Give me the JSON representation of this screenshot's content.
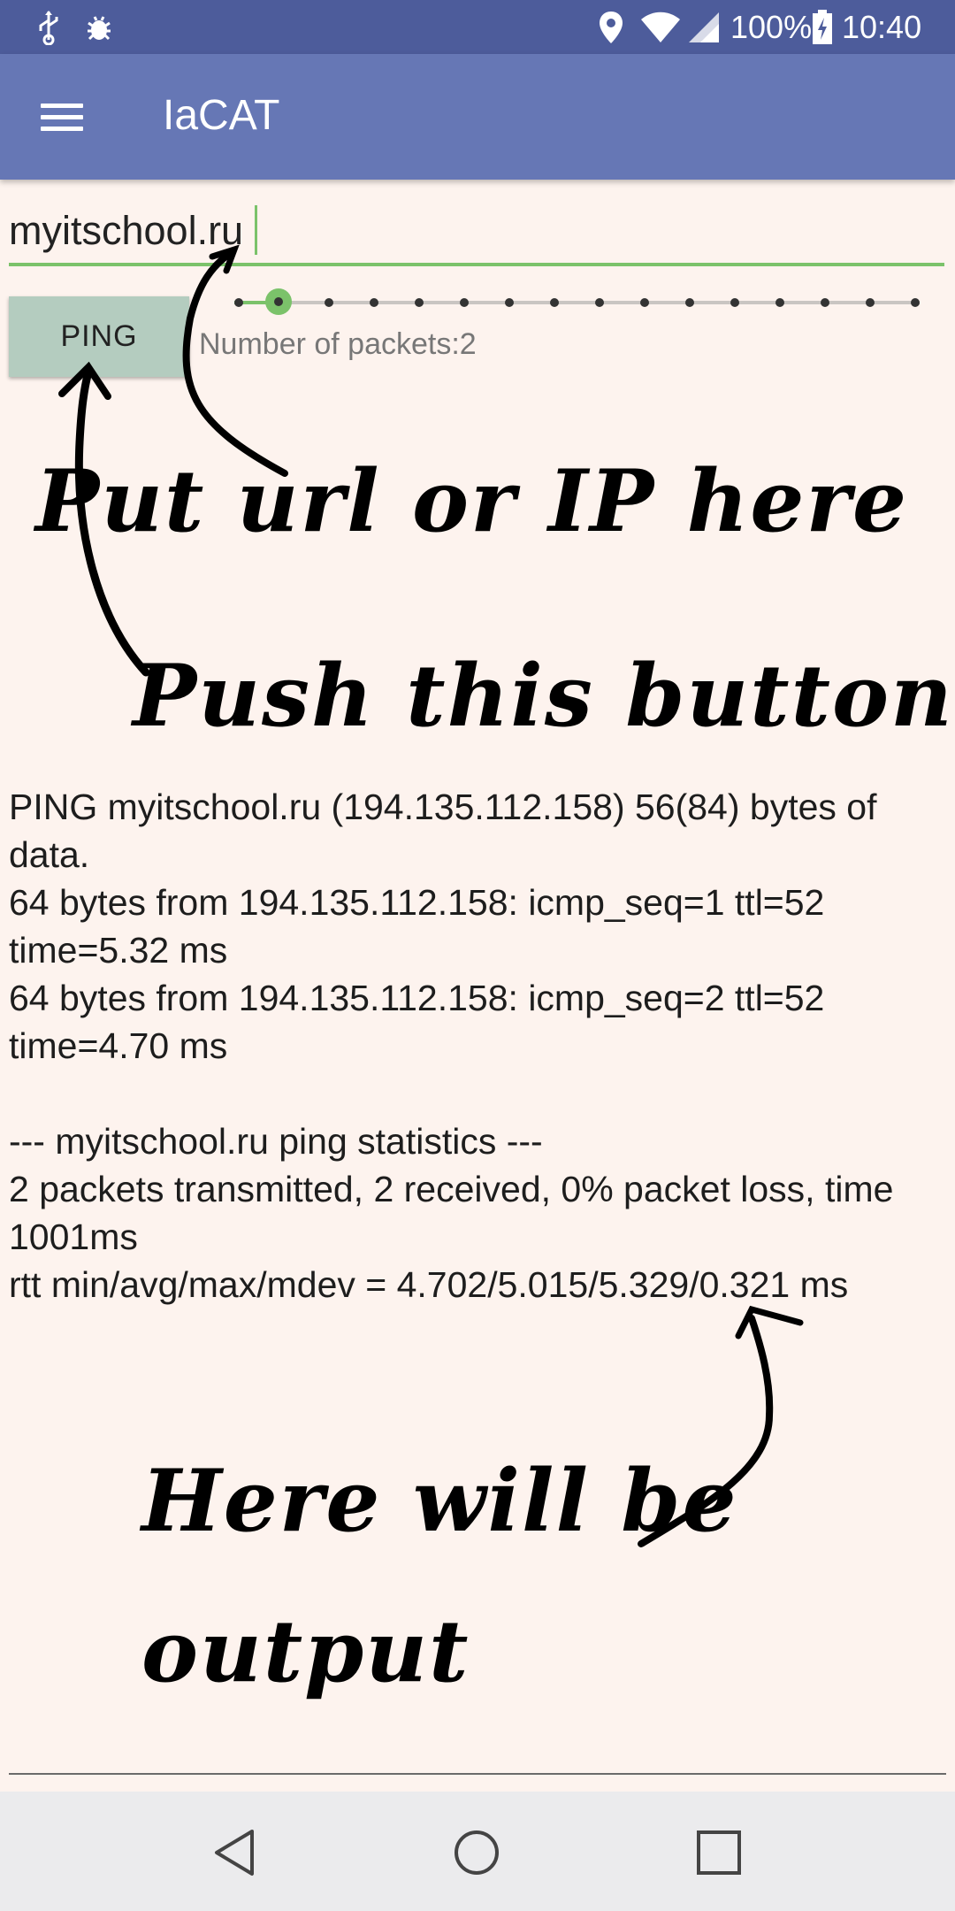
{
  "status_bar": {
    "battery": "100%",
    "time": "10:40",
    "icons": [
      "usb-icon",
      "bug-icon",
      "location-icon",
      "wifi-icon",
      "signal-icon",
      "battery-charging-icon"
    ]
  },
  "app_bar": {
    "title": "IaCAT",
    "menu_icon": "hamburger-menu-icon"
  },
  "ping_form": {
    "url_value": "myitschool.ru",
    "ping_label": "PING",
    "packets_label": "Number of packets:2",
    "packets_value": 2,
    "slider_steps": 16
  },
  "annotations": {
    "put_url": "Put url or IP here",
    "push_button": "Push this button",
    "output_line1": "Here will be",
    "output_line2": "output"
  },
  "output_lines": [
    "PING myitschool.ru (194.135.112.158) 56(84) bytes of data.",
    "64 bytes from 194.135.112.158: icmp_seq=1 ttl=52 time=5.32 ms",
    "64 bytes from 194.135.112.158: icmp_seq=2 ttl=52 time=4.70 ms",
    "",
    "--- myitschool.ru ping statistics ---",
    "2 packets transmitted, 2 received, 0% packet loss, time 1001ms",
    "rtt min/avg/max/mdev = 4.702/5.015/5.329/0.321 ms"
  ],
  "nav_bar": {
    "icons": [
      "back-icon",
      "home-icon",
      "recents-icon"
    ]
  },
  "colors": {
    "status_bar": "#4d5c9b",
    "app_bar": "#6677b5",
    "accent": "#7bc26a",
    "background": "#fdf3ee",
    "button": "#b4ccbf"
  }
}
